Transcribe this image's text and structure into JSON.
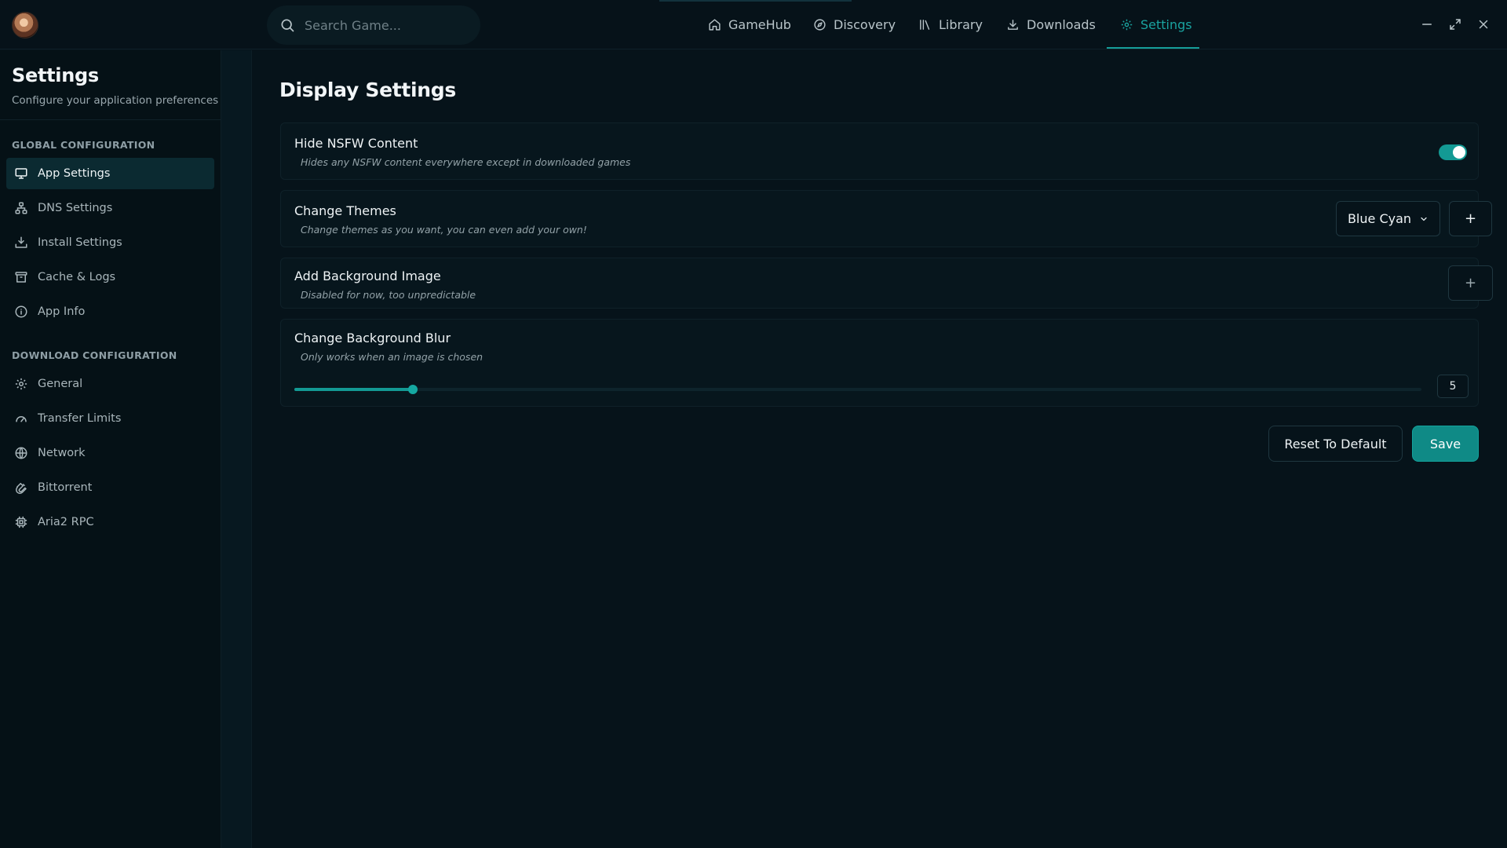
{
  "topbar": {
    "search": {
      "placeholder": "Search Game..."
    },
    "nav": [
      {
        "label": "GameHub",
        "icon": "home-icon",
        "active": false
      },
      {
        "label": "Discovery",
        "icon": "compass-icon",
        "active": false
      },
      {
        "label": "Library",
        "icon": "library-icon",
        "active": false
      },
      {
        "label": "Downloads",
        "icon": "download-icon",
        "active": false
      },
      {
        "label": "Settings",
        "icon": "gear-icon",
        "active": true
      }
    ],
    "window_controls": [
      "minimize-icon",
      "restore-icon",
      "close-icon"
    ]
  },
  "sidebar": {
    "title": "Settings",
    "subtitle": "Configure your application preferences",
    "sections": [
      {
        "label": "Global Configuration",
        "items": [
          {
            "label": "App Settings",
            "icon": "monitor-icon",
            "active": true
          },
          {
            "label": "DNS Settings",
            "icon": "network-nodes-icon",
            "active": false
          },
          {
            "label": "Install Settings",
            "icon": "install-icon",
            "active": false
          },
          {
            "label": "Cache & Logs",
            "icon": "archive-icon",
            "active": false
          },
          {
            "label": "App Info",
            "icon": "info-icon",
            "active": false
          }
        ]
      },
      {
        "label": "Download Configuration",
        "items": [
          {
            "label": "General",
            "icon": "gear-icon",
            "active": false
          },
          {
            "label": "Transfer Limits",
            "icon": "gauge-icon",
            "active": false
          },
          {
            "label": "Network",
            "icon": "globe-icon",
            "active": false
          },
          {
            "label": "Bittorrent",
            "icon": "magnet-icon",
            "active": false
          },
          {
            "label": "Aria2 RPC",
            "icon": "chip-icon",
            "active": false
          }
        ]
      }
    ]
  },
  "main": {
    "title": "Display Settings",
    "settings": {
      "nsfw": {
        "title": "Hide NSFW Content",
        "description": "Hides any NSFW content everywhere except in downloaded games",
        "enabled": true
      },
      "themes": {
        "title": "Change Themes",
        "description": "Change themes as you want, you can even add your own!",
        "selected": "Blue Cyan",
        "add_label": "+"
      },
      "background_image": {
        "title": "Add Background Image",
        "description": "Disabled for now, too unpredictable",
        "add_label": "+"
      },
      "background_blur": {
        "title": "Change Background Blur",
        "description": "Only works when an image is chosen",
        "value": "5",
        "fraction": 0.105
      }
    },
    "actions": {
      "reset_label": "Reset To Default",
      "save_label": "Save"
    }
  },
  "colors": {
    "accent": "#139a94",
    "background": "#06131a",
    "sidebar": "#051116",
    "active_item": "#0b2a31"
  }
}
